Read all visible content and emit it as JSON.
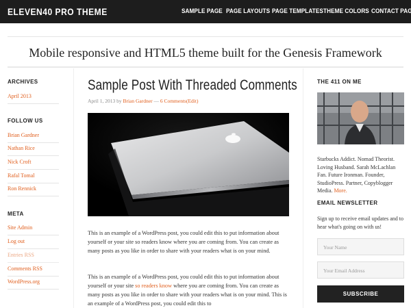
{
  "header": {
    "logo": "ELEVEN40 PRO THEME",
    "nav": [
      "SAMPLE PAGE",
      "PAGE LAYOUTS",
      "PAGE TEMPLATES",
      "THEME COLORS",
      "CONTACT PAGE"
    ]
  },
  "tagline": "Mobile responsive and HTML5 theme built for the Genesis Framework",
  "left_sidebar": {
    "archives": {
      "title": "ARCHIVES",
      "items": [
        "April 2013"
      ]
    },
    "follow": {
      "title": "FOLLOW US",
      "items": [
        "Brian Gardner",
        "Nathan Rice",
        "Nick Croft",
        "Rafal Tomal",
        "Ron Rennick"
      ]
    },
    "meta": {
      "title": "META",
      "items": [
        "Site Admin",
        "Log out",
        "Entries RSS",
        "Comments RSS",
        "WordPress.org"
      ]
    }
  },
  "post": {
    "title": "Sample Post With Threaded Comments",
    "date": "April 1, 2013",
    "by": "by",
    "author": "Brian Gardner",
    "dash": "—",
    "comments": "6 Comments",
    "edit": "(Edit)",
    "para1": "This is an example of a WordPress post, you could edit this to put information about yourself or your site so readers know where you are coming from. You can create as many posts as you like in order to share with your readers what is on your mind.",
    "para2_a": "This is an example of a WordPress post, you could edit this to put information about yourself or your site ",
    "para2_link": "so readers know",
    "para2_b": " where you are coming from. You can create as many posts as you like in order to share with your readers what is on your mind. This is an example of a WordPress post, you could edit this to"
  },
  "right_sidebar": {
    "about_title": "THE 411 ON ME",
    "bio": "Starbucks Addict. Nomad Theorist. Loving Husband. Sarah McLachlan Fan. Future Ironman. Founder, StudioPress. Partner, Copyblogger Media.",
    "more": "More.",
    "newsletter_title": "EMAIL NEWSLETTER",
    "newsletter_text": "Sign up to receive email updates and to hear what's going on with us!",
    "name_placeholder": "Your Name",
    "email_placeholder": "Your Email Address",
    "subscribe": "SUBSCRIBE"
  },
  "colors": {
    "accent": "#e05d1b",
    "header_bg": "#1d1d1d"
  }
}
